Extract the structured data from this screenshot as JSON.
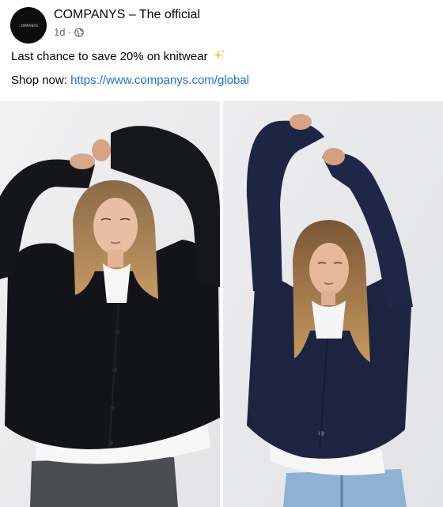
{
  "post": {
    "page_name": "COMPANYS – The official",
    "avatar_text": "COMPANYS",
    "time_ago": "1d",
    "separator": "·",
    "text": "Last chance to save 20% on knitwear",
    "shop_label": "Shop now:",
    "shop_url": "https://www.companys.com/global",
    "icons": {
      "audience": "globe-icon",
      "emoji": "sparkle-icon"
    }
  },
  "colors": {
    "link": "#216fdb",
    "meta_text": "#65676b",
    "sweater_left": "#111317",
    "sweater_right": "#1b2340",
    "photo_bg": "#ebebec"
  }
}
